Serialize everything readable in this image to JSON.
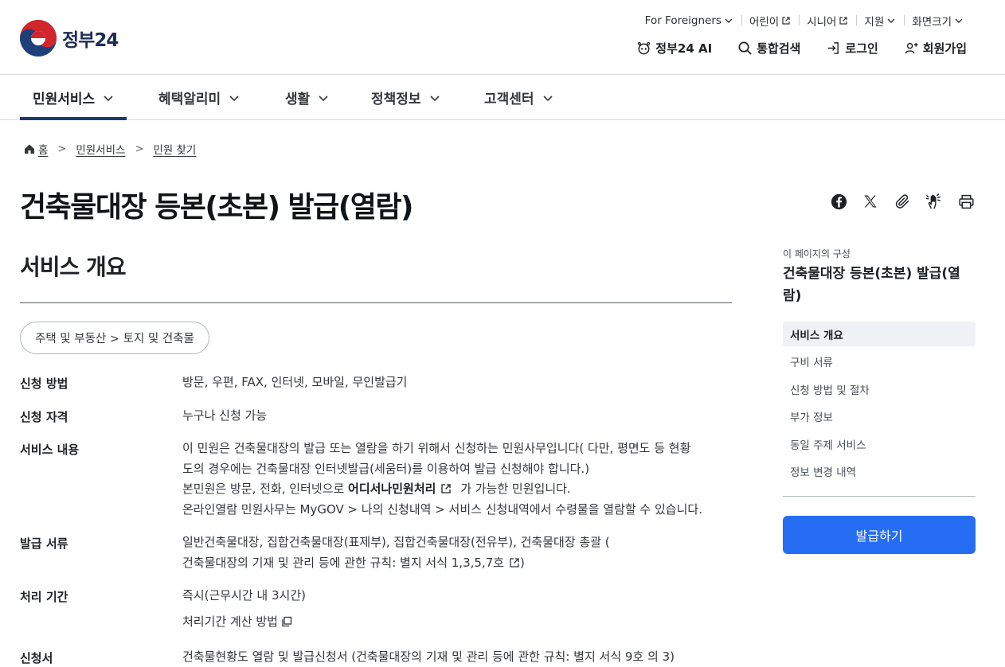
{
  "header": {
    "logo_text": "정부24",
    "utility": [
      {
        "label": "For Foreigners",
        "icon": "chevron-down-icon"
      },
      {
        "label": "어린이",
        "icon": "external-link-icon"
      },
      {
        "label": "시니어",
        "icon": "external-link-icon"
      },
      {
        "label": "지원",
        "icon": "chevron-down-icon"
      },
      {
        "label": "화면크기",
        "icon": "chevron-down-icon"
      }
    ],
    "quick": [
      {
        "label": "정부24 AI",
        "icon": "ai-robot-icon"
      },
      {
        "label": "통합검색",
        "icon": "search-icon"
      },
      {
        "label": "로그인",
        "icon": "login-icon"
      },
      {
        "label": "회원가입",
        "icon": "user-plus-icon"
      }
    ]
  },
  "gnb": [
    {
      "label": "민원서비스",
      "active": true
    },
    {
      "label": "혜택알리미",
      "active": false
    },
    {
      "label": "생활",
      "active": false
    },
    {
      "label": "정책정보",
      "active": false
    },
    {
      "label": "고객센터",
      "active": false
    }
  ],
  "breadcrumb": [
    "홈",
    "민원서비스",
    "민원 찾기"
  ],
  "page": {
    "title": "건축물대장 등본(초본) 발급(열람)",
    "section_title": "서비스 개요",
    "category": "주택 및 부동산 > 토지 및 건축물"
  },
  "share_icons": [
    "facebook-icon",
    "x-twitter-icon",
    "link-clip-icon",
    "sign-language-icon",
    "print-icon"
  ],
  "overview": {
    "method": {
      "label": "신청 방법",
      "value": "방문, 우편, FAX, 인터넷, 모바일, 무인발급기"
    },
    "eligibility": {
      "label": "신청 자격",
      "value": "누구나 신청 가능"
    },
    "content": {
      "label": "서비스 내용",
      "line1": "이 민원은 건축물대장의 발급 또는 열람을 하기 위해서 신청하는 민원사무입니다( 다만, 평면도 등 현황",
      "line2": "도의 경우에는 건축물대장 인터넷발급(세움터)를 이용하여 발급 신청해야 합니다.)",
      "line3_pre": "본민원은 방문, 전화, 인터넷으로 ",
      "line3_link": "어디서나민원처리",
      "line3_post": " 가 가능한 민원입니다.",
      "line4": "온라인열람 민원사무는 MyGOV > 나의 신청내역 > 서비스 신청내역에서 수령물을 열람할 수 있습니다."
    },
    "documents": {
      "label": "발급 서류",
      "line1": "일반건축물대장, 집합건축물대장(표제부), 집합건축물대장(전유부), 건축물대장 총괄 (",
      "line2_link": "건축물대장의 기재 및 관리 등에 관한 규칙: 별지 서식 1,3,5,7호",
      "line2_post": ")"
    },
    "period": {
      "label": "처리 기간",
      "value": "즉시(근무시간 내 3시간)",
      "sub": "처리기간 계산 방법"
    },
    "form": {
      "label": "신청서",
      "value": "건축물현황도 열람 및 발급신청서 (건축물대장의 기재 및 관리 등에 관한 규칙: 별지 서식 9호 의 3)"
    }
  },
  "side_nav": {
    "caption": "이 페이지의 구성",
    "title": "건축물대장 등본(초본) 발급(열람)",
    "items": [
      "서비스 개요",
      "구비 서류",
      "신청 방법 및 절차",
      "부가 정보",
      "동일 주제 서비스",
      "정보 변경 내역"
    ],
    "active_index": 0,
    "apply_label": "발급하기"
  },
  "colors": {
    "primary": "#256ef4",
    "navy": "#1e3a6e",
    "text": "#1e2124"
  }
}
